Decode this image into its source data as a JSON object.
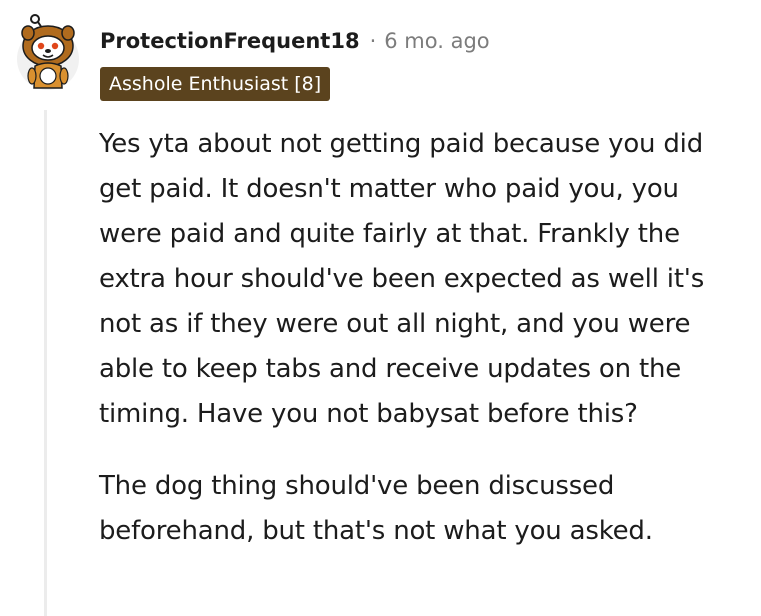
{
  "comment": {
    "username": "ProtectionFrequent18",
    "separator": "·",
    "timestamp": "6 mo. ago",
    "flair": "Asshole Enthusiast [8]",
    "paragraphs": [
      "Yes yta about not getting paid because you did get paid. It doesn't matter who paid you, you were paid and quite fairly at that. Frankly the extra hour should've been expected as well it's not as if they were out all night, and you were able to keep tabs and receive updates on the timing. Have you not babysat before this?",
      "The dog thing should've been discussed beforehand, but that's not what you asked."
    ]
  },
  "colors": {
    "flair_background": "#5b431e",
    "flair_text": "#ffffff",
    "meta_gray": "#7c7c7c",
    "thread_line": "#ececec"
  },
  "icons": {
    "avatar": "snoo-lion-costume-avatar"
  }
}
